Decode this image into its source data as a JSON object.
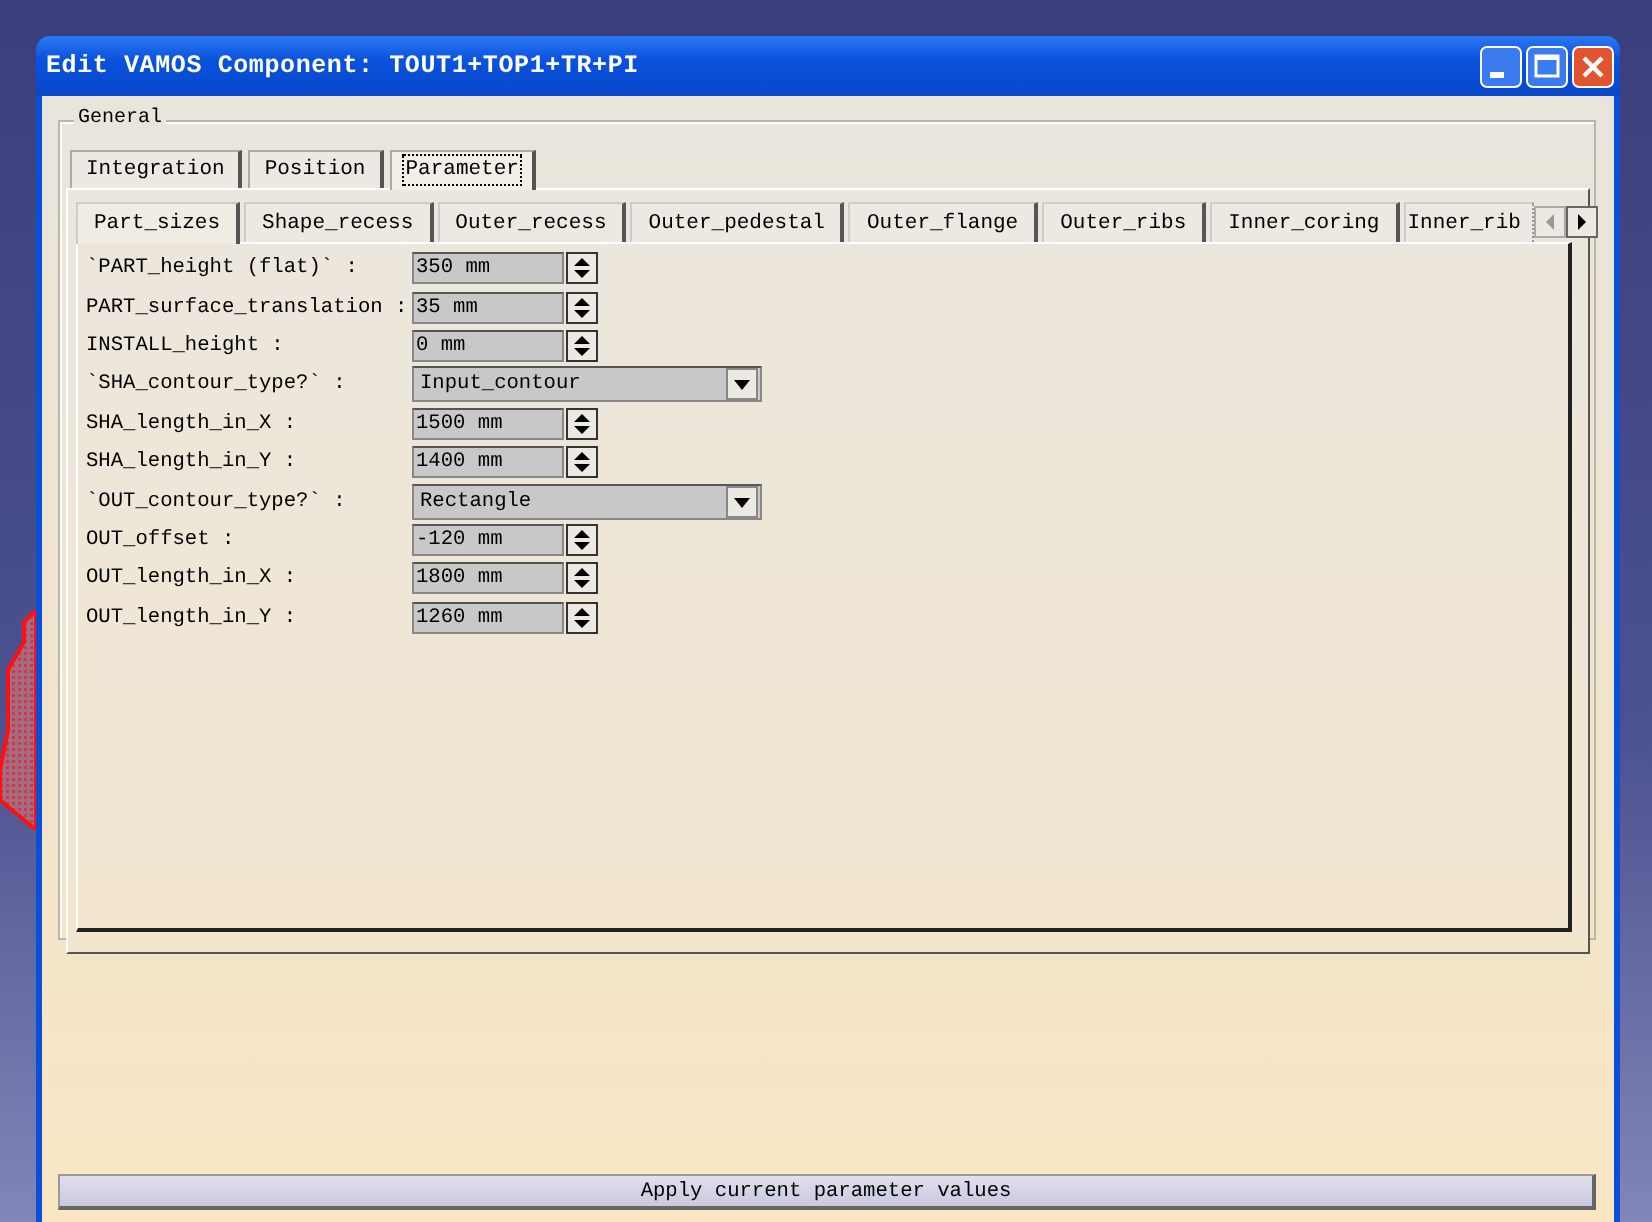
{
  "window": {
    "title": "Edit VAMOS Component: TOUT1+TOP1+TR+PI"
  },
  "group": {
    "legend": "General"
  },
  "tabs": [
    {
      "label": "Integration",
      "selected": false
    },
    {
      "label": "Position",
      "selected": false
    },
    {
      "label": "Parameter",
      "selected": true
    }
  ],
  "subtabs": [
    {
      "label": "Part_sizes",
      "selected": true
    },
    {
      "label": "Shape_recess",
      "selected": false
    },
    {
      "label": "Outer_recess",
      "selected": false
    },
    {
      "label": "Outer_pedestal",
      "selected": false
    },
    {
      "label": "Outer_flange",
      "selected": false
    },
    {
      "label": "Outer_ribs",
      "selected": false
    },
    {
      "label": "Inner_coring",
      "selected": false
    },
    {
      "label": "Inner_rib",
      "selected": false
    }
  ],
  "fields": [
    {
      "kind": "spin",
      "label": "`PART_height (flat)` :",
      "value": "350 mm"
    },
    {
      "kind": "spin",
      "label": "PART_surface_translation :",
      "value": "35 mm"
    },
    {
      "kind": "spin",
      "label": "INSTALL_height :",
      "value": "0 mm"
    },
    {
      "kind": "combo",
      "label": "`SHA_contour_type?` :",
      "value": "Input_contour"
    },
    {
      "kind": "spin",
      "label": "SHA_length_in_X :",
      "value": "1500 mm"
    },
    {
      "kind": "spin",
      "label": "SHA_length_in_Y :",
      "value": "1400 mm"
    },
    {
      "kind": "combo",
      "label": "`OUT_contour_type?` :",
      "value": "Rectangle"
    },
    {
      "kind": "spin",
      "label": "OUT_offset :",
      "value": "-120 mm"
    },
    {
      "kind": "spin",
      "label": "OUT_length_in_X :",
      "value": "1800 mm"
    },
    {
      "kind": "spin",
      "label": "OUT_length_in_Y :",
      "value": "1260 mm"
    }
  ],
  "apply_button": {
    "label": "Apply current parameter values"
  }
}
